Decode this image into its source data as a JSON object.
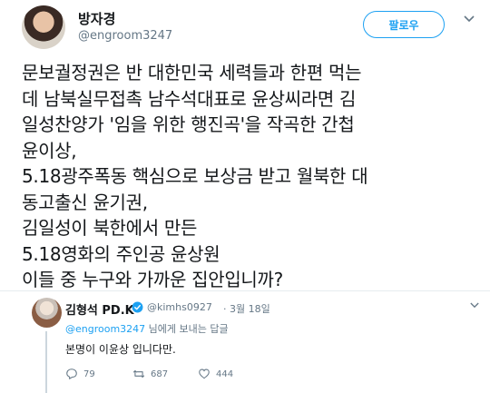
{
  "tweet": {
    "author_name": "방자경",
    "author_handle": "@engroom3247",
    "follow_label": "팔로우",
    "lines": [
      "문보궐정권은 반 대한민국 세력들과 한편 먹는",
      "데 남북실무접촉 남수석대표로 윤상씨라면 김",
      "일성찬양가 '임을 위한 행진곡'을 작곡한 간첩",
      "윤이상,",
      "5.18광주폭동 핵심으로 보상금 받고 월북한 대",
      "동고출신 윤기권,",
      "김일성이 북한에서 만든",
      "5.18영화의 주인공 윤상원",
      "이들 중 누구와 가까운 집안입니까?"
    ]
  },
  "reply": {
    "author_name": "김형석 PD.K",
    "author_handle": "@kimhs0927",
    "date": "· 3월 18일",
    "replying_to_handle": "@engroom3247",
    "replying_to_suffix": " 님에게 보내는 답글",
    "text": "본명이 이윤상 입니다만.",
    "reply_count": "79",
    "retweet_count": "687",
    "like_count": "444"
  },
  "icons": {
    "menu": "chevron-down-icon",
    "verified": "verified-badge-icon",
    "reply": "reply-icon",
    "retweet": "retweet-icon",
    "like": "heart-icon"
  },
  "colors": {
    "accent": "#1da1f2",
    "muted": "#657786",
    "text": "#14171a"
  }
}
